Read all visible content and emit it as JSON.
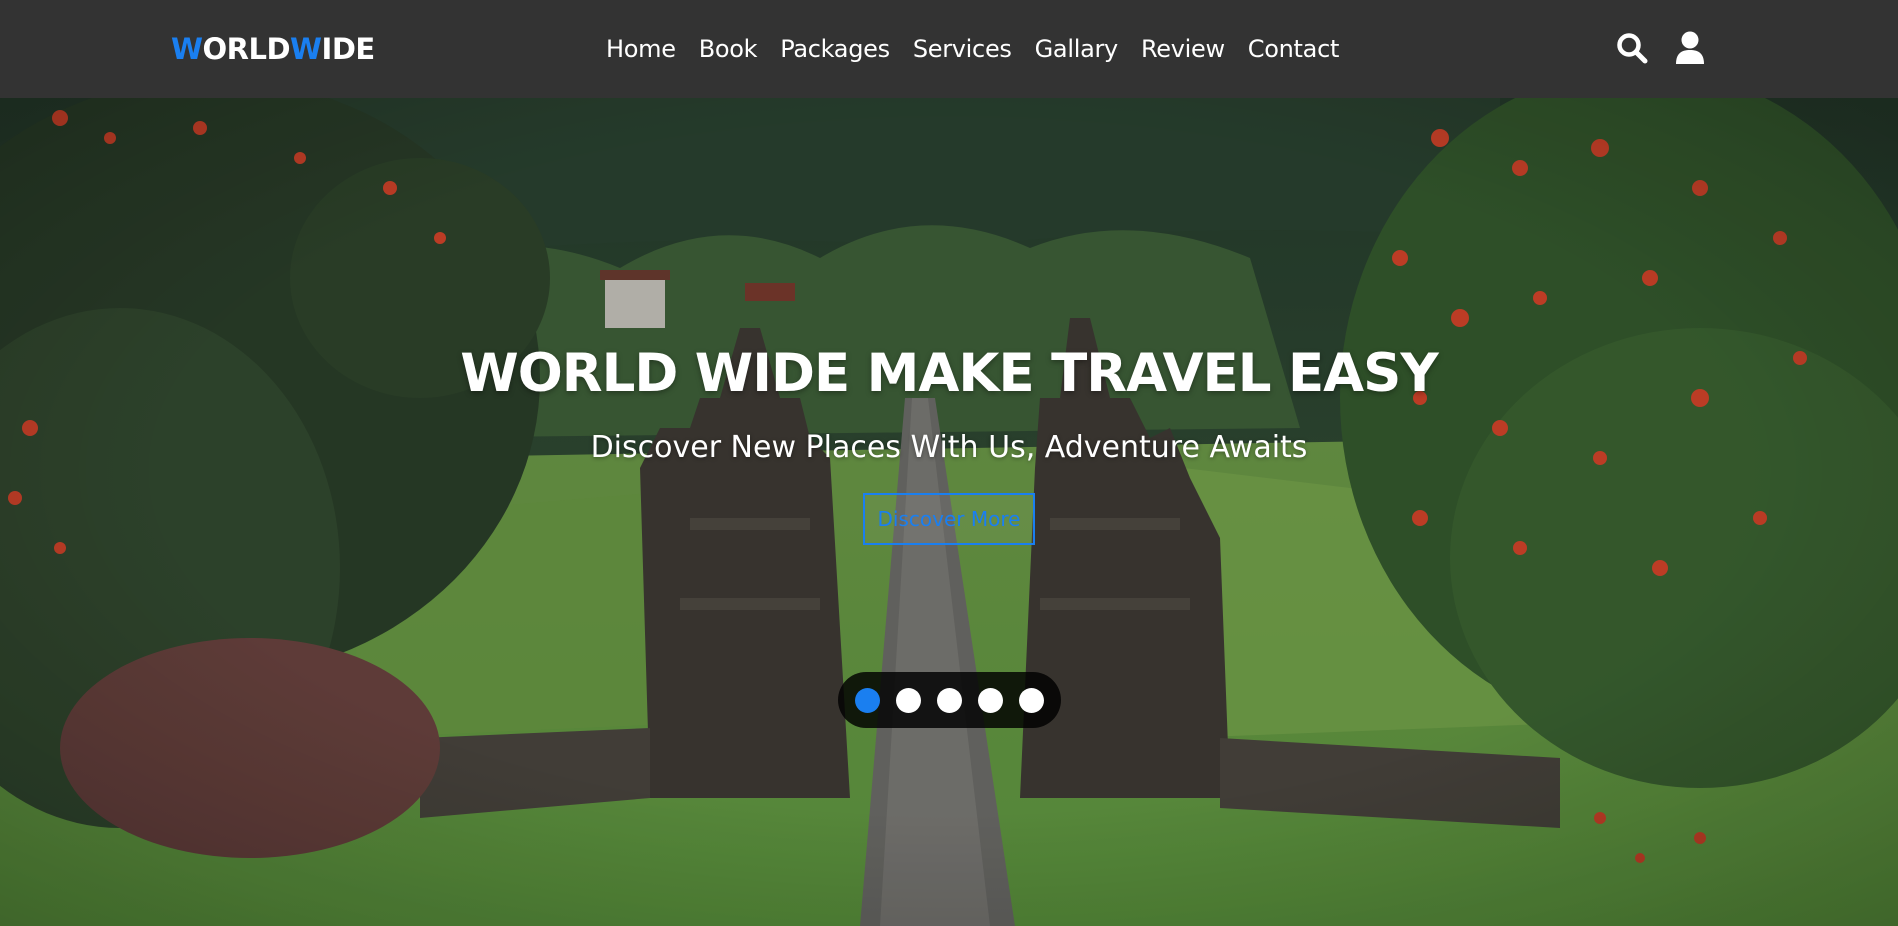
{
  "brand": {
    "part1": "W",
    "part2": "ORLD",
    "part3": "W",
    "part4": "IDE"
  },
  "nav": {
    "items": [
      {
        "label": "Home"
      },
      {
        "label": "Book"
      },
      {
        "label": "Packages"
      },
      {
        "label": "Services"
      },
      {
        "label": "Gallary"
      },
      {
        "label": "Review"
      },
      {
        "label": "Contact"
      }
    ],
    "icons": [
      "search-icon",
      "user-icon"
    ]
  },
  "hero": {
    "title": "WORLD WIDE MAKE TRAVEL EASY",
    "subtitle": "Discover New Places With Us, Adventure Awaits",
    "button_label": "Discover More",
    "slides_total": 5,
    "active_slide": 1
  },
  "colors": {
    "accent": "#1a7ff0",
    "navbar_bg": "#333333",
    "text": "#ffffff"
  }
}
